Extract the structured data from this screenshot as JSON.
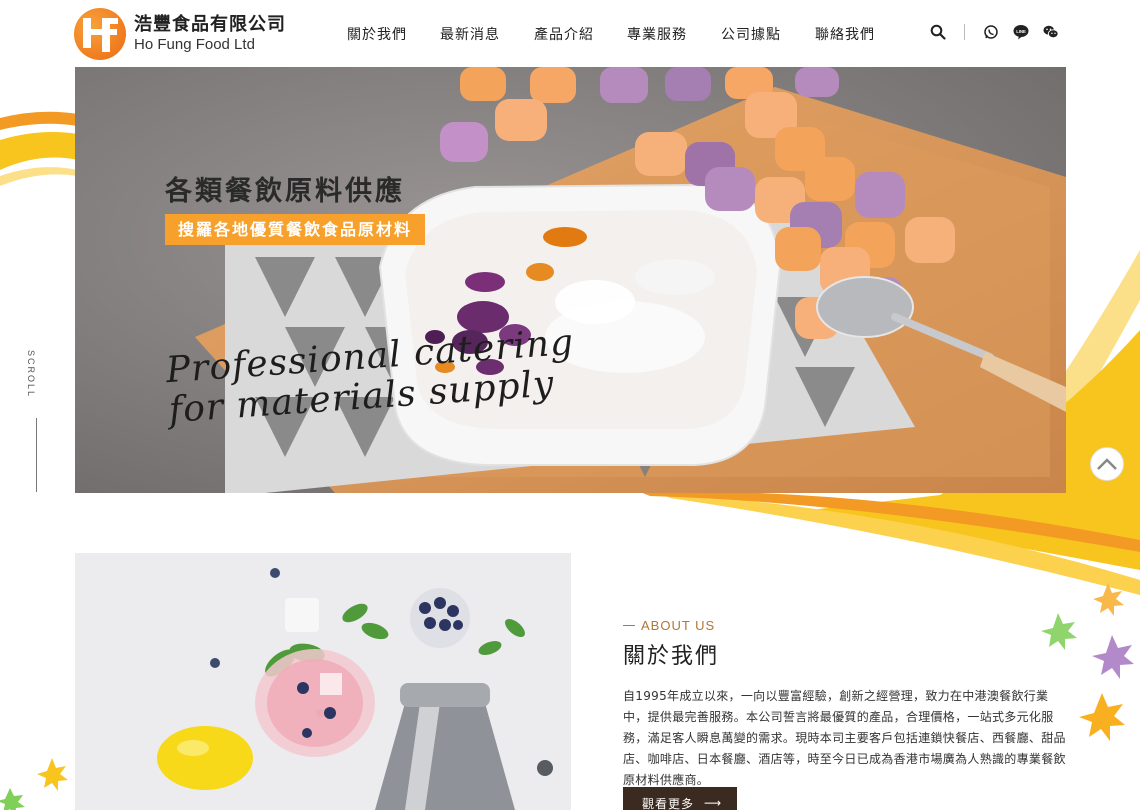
{
  "brand": {
    "name_cn": "浩豐食品有限公司",
    "name_en": "Ho Fung Food Ltd"
  },
  "nav": {
    "items": [
      "關於我們",
      "最新消息",
      "產品介紹",
      "專業服務",
      "公司據點",
      "聯絡我們"
    ]
  },
  "tools": {
    "icons": [
      "search-icon",
      "whatsapp-icon",
      "line-icon",
      "wechat-icon"
    ]
  },
  "hero": {
    "title": "各類餐飲原料供應",
    "subtitle": "搜羅各地優質餐飲食品原材料",
    "script_line1": "Professional catering",
    "script_line2": "for materials supply"
  },
  "scroll": {
    "label": "SCROLL"
  },
  "about": {
    "eyebrow": "ABOUT US",
    "title": "關於我們",
    "body": "自1995年成立以來，一向以豐富經驗，創新之經營理，致力在中港澳餐飲行業中，提供最完善服務。本公司誓言將最優質的產品，合理價格，一站式多元化服務，滿足客人瞬息萬變的需求。現時本司主要客戶包括連鎖快餐店、西餐廳、甜品店、咖啡店、日本餐廳、酒店等，時至今日已成為香港市場廣為人熟識的專業餐飲原材料供應商。",
    "more_label": "觀看更多"
  },
  "colors": {
    "brand_orange": "#f18a24",
    "accent_yellow": "#f7c21c",
    "button_dark": "#3b2a1f",
    "eyebrow": "#b07735"
  }
}
